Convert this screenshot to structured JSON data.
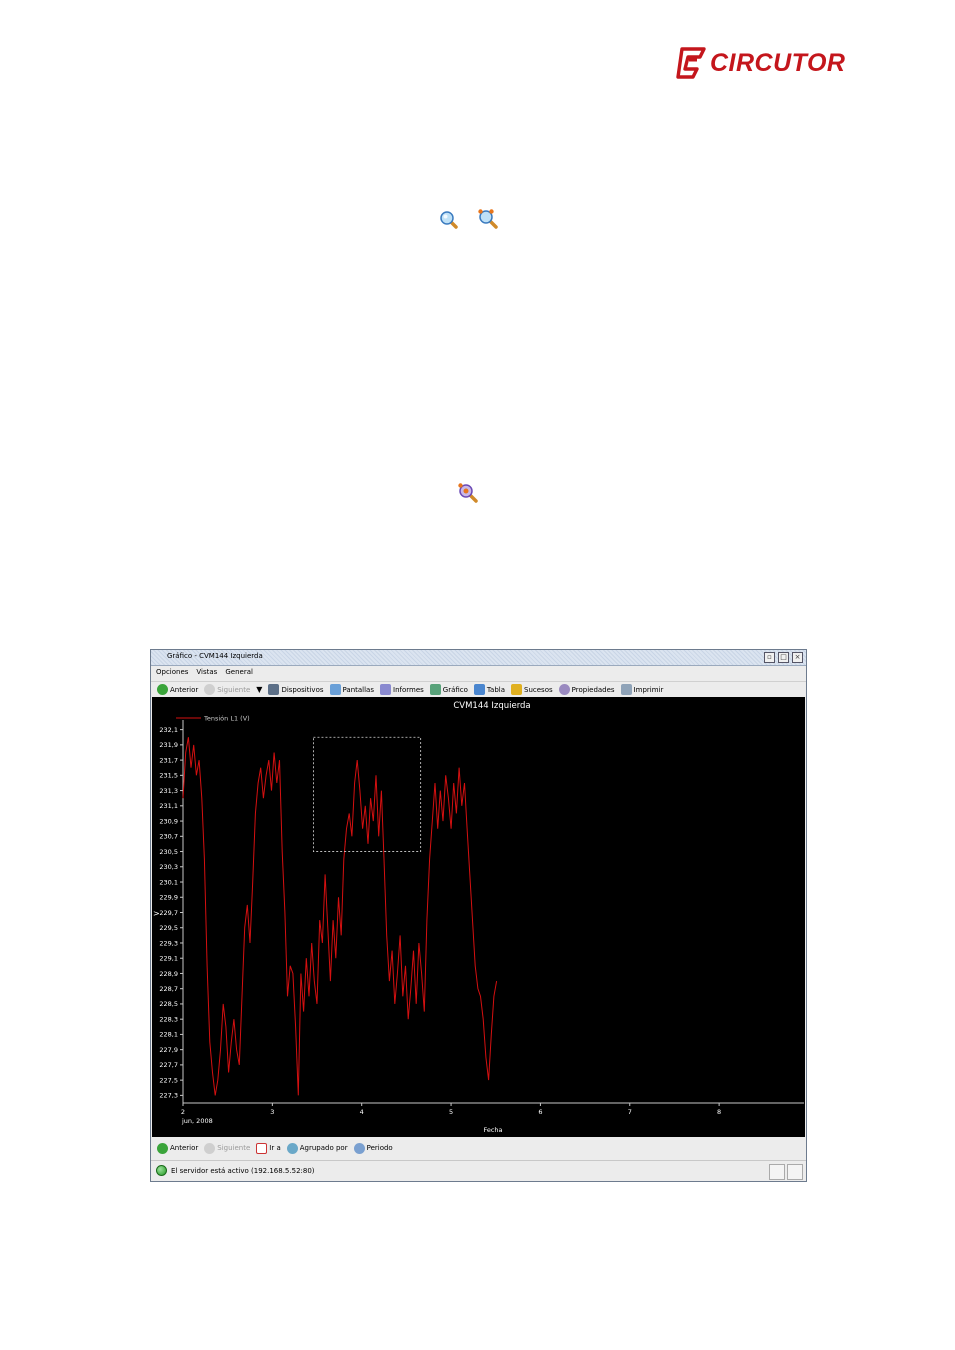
{
  "brand": {
    "name": "CIRCUTOR",
    "color": "#c4161c"
  },
  "doc_icons": [
    {
      "name": "zoom-in-icon"
    },
    {
      "name": "zoom-out-icon"
    },
    {
      "name": "zoom-reset-icon"
    }
  ],
  "window": {
    "title": "Gráfico - CVM144 Izquierda",
    "menu": [
      "Opciones",
      "Vistas",
      "General"
    ],
    "toolbar_top": [
      {
        "label": "Anterior",
        "icon": "back-arrow-icon",
        "enabled": true
      },
      {
        "label": "Siguiente",
        "icon": "forward-arrow-icon",
        "enabled": false
      },
      {
        "label": "Dispositivos",
        "icon": "devices-icon",
        "enabled": true
      },
      {
        "label": "Pantallas",
        "icon": "screens-icon",
        "enabled": true
      },
      {
        "label": "Informes",
        "icon": "reports-icon",
        "enabled": true
      },
      {
        "label": "Gráfico",
        "icon": "chart-icon",
        "enabled": true
      },
      {
        "label": "Tabla",
        "icon": "table-icon",
        "enabled": true
      },
      {
        "label": "Sucesos",
        "icon": "events-icon",
        "enabled": true
      },
      {
        "label": "Propiedades",
        "icon": "properties-icon",
        "enabled": true
      },
      {
        "label": "Imprimir",
        "icon": "print-icon",
        "enabled": true
      }
    ],
    "toolbar_bottom": [
      {
        "label": "Anterior",
        "icon": "back-arrow-icon",
        "enabled": true
      },
      {
        "label": "Siguiente",
        "icon": "forward-arrow-icon",
        "enabled": false
      },
      {
        "label": "Ir a",
        "icon": "calendar-icon",
        "enabled": true
      },
      {
        "label": "Agrupado por",
        "icon": "group-icon",
        "enabled": true
      },
      {
        "label": "Periodo",
        "icon": "period-icon",
        "enabled": true
      }
    ],
    "status": "El servidor está activo (192.168.5.52:80)"
  },
  "chart_data": {
    "type": "line",
    "title": "CVM144 Izquierda",
    "xlabel": "Fecha",
    "ylabel": "",
    "x_ticks": [
      "2",
      "3",
      "4",
      "5",
      "6",
      "7",
      "8"
    ],
    "x_first_sublabel": "jun, 2008",
    "xlim": [
      2,
      8.95
    ],
    "ylim": [
      227.2,
      232.2
    ],
    "y_ticks": [
      "232,1",
      "231,9",
      "231,7",
      "231,5",
      "231,3",
      "231,1",
      "230,9",
      "230,7",
      "230,5",
      "230,3",
      "230,1",
      "229,9",
      "229,7",
      "229,5",
      "229,3",
      "229,1",
      "228,9",
      "228,7",
      "228,5",
      "228,3",
      "228,1",
      "227,9",
      "227,7",
      "227,5",
      "227,3"
    ],
    "y_tick_values": [
      232.1,
      231.9,
      231.7,
      231.5,
      231.3,
      231.1,
      230.9,
      230.7,
      230.5,
      230.3,
      230.1,
      229.9,
      229.7,
      229.5,
      229.3,
      229.1,
      228.9,
      228.7,
      228.5,
      228.3,
      228.1,
      227.9,
      227.7,
      227.5,
      227.3
    ],
    "legend": "top-left",
    "grid": false,
    "series": [
      {
        "name": "Tensión L1 (V)",
        "color": "#d41010",
        "x": [
          2.0,
          2.03,
          2.06,
          2.09,
          2.12,
          2.15,
          2.18,
          2.21,
          2.24,
          2.27,
          2.3,
          2.33,
          2.36,
          2.39,
          2.42,
          2.45,
          2.48,
          2.51,
          2.54,
          2.57,
          2.6,
          2.63,
          2.66,
          2.69,
          2.72,
          2.75,
          2.78,
          2.81,
          2.84,
          2.87,
          2.9,
          2.93,
          2.96,
          2.99,
          3.02,
          3.05,
          3.08,
          3.11,
          3.14,
          3.17,
          3.2,
          3.23,
          3.26,
          3.29,
          3.32,
          3.35,
          3.38,
          3.41,
          3.44,
          3.47,
          3.5,
          3.53,
          3.56,
          3.59,
          3.62,
          3.65,
          3.68,
          3.71,
          3.74,
          3.77,
          3.8,
          3.83,
          3.86,
          3.89,
          3.92,
          3.95,
          3.98,
          4.01,
          4.04,
          4.07,
          4.1,
          4.13,
          4.16,
          4.19,
          4.22,
          4.25,
          4.28,
          4.31,
          4.34,
          4.37,
          4.4,
          4.43,
          4.46,
          4.49,
          4.52,
          4.55,
          4.58,
          4.61,
          4.64,
          4.67,
          4.7,
          4.73,
          4.76,
          4.79,
          4.82,
          4.85,
          4.88,
          4.91,
          4.94,
          4.97,
          5.0,
          5.03,
          5.06,
          5.09,
          5.12,
          5.15,
          5.18,
          5.21,
          5.24,
          5.27,
          5.3,
          5.33,
          5.36,
          5.39,
          5.42,
          5.45,
          5.48,
          5.51
        ],
        "y": [
          231.2,
          231.8,
          232.0,
          231.6,
          231.9,
          231.5,
          231.7,
          231.2,
          230.4,
          229.0,
          228.0,
          227.6,
          227.3,
          227.5,
          227.9,
          228.5,
          228.2,
          227.6,
          228.0,
          228.3,
          227.9,
          227.7,
          228.6,
          229.5,
          229.8,
          229.3,
          230.1,
          231.0,
          231.4,
          231.6,
          231.2,
          231.5,
          231.7,
          231.3,
          231.8,
          231.4,
          231.7,
          230.5,
          229.7,
          228.6,
          229.0,
          228.9,
          228.2,
          227.3,
          228.9,
          228.4,
          229.1,
          228.6,
          229.3,
          228.8,
          228.5,
          229.6,
          229.3,
          230.2,
          229.5,
          228.8,
          229.6,
          229.1,
          229.9,
          229.4,
          230.4,
          230.8,
          231.0,
          230.7,
          231.4,
          231.7,
          231.3,
          230.8,
          231.1,
          230.6,
          231.2,
          230.9,
          231.5,
          230.7,
          231.3,
          230.4,
          229.4,
          228.8,
          229.2,
          228.5,
          228.9,
          229.4,
          228.6,
          229.0,
          228.3,
          228.7,
          229.2,
          228.5,
          229.3,
          228.9,
          228.4,
          229.6,
          230.4,
          230.9,
          231.4,
          230.8,
          231.3,
          230.9,
          231.5,
          231.2,
          230.8,
          231.4,
          231.0,
          231.6,
          231.1,
          231.4,
          230.8,
          230.2,
          229.6,
          229.0,
          228.7,
          228.6,
          228.3,
          227.8,
          227.5,
          228.1,
          228.6,
          228.8
        ]
      }
    ],
    "selection_box": {
      "x": [
        3.46,
        4.66
      ],
      "y": [
        230.5,
        232.0
      ]
    }
  }
}
